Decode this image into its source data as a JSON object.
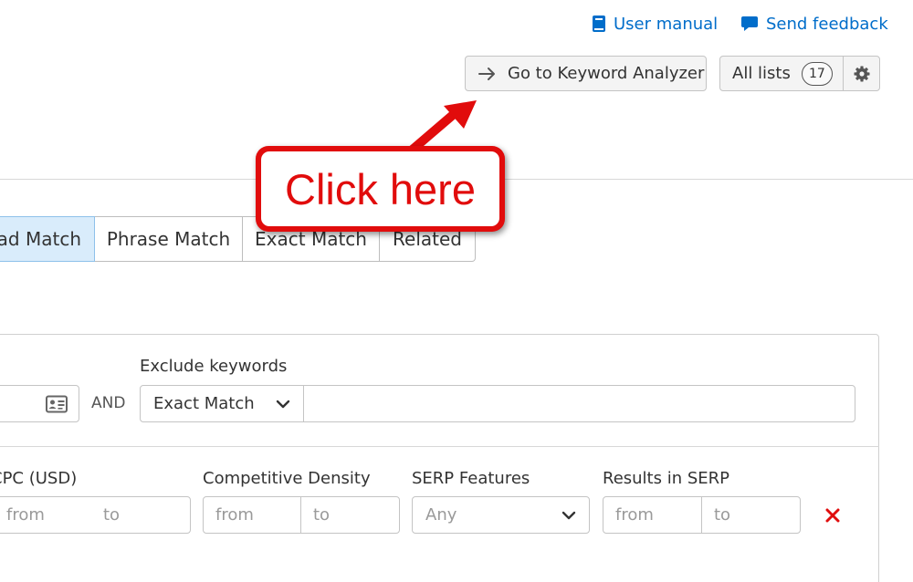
{
  "header": {
    "user_manual": "User manual",
    "send_feedback": "Send feedback"
  },
  "toolbar": {
    "goto_analyzer": "Go to Keyword Analyzer",
    "all_lists": "All lists",
    "lists_count": "17"
  },
  "tabs": [
    {
      "label": "Broad Match",
      "visible": "ad Match",
      "active": true
    },
    {
      "label": "Phrase Match",
      "active": false
    },
    {
      "label": "Exact Match",
      "active": false
    },
    {
      "label": "Related",
      "active": false
    }
  ],
  "filters": {
    "and_label": "AND",
    "exclude_label": "Exclude keywords",
    "exclude_match": "Exact Match",
    "exclude_value": "",
    "cpc_label": "CPC (USD)",
    "cpc_label_visible": "CPC (USD)",
    "density_label": "Competitive Density",
    "serp_label": "SERP Features",
    "serp_value": "Any",
    "results_label": "Results in SERP",
    "from_placeholder": "from",
    "to_placeholder": "to"
  },
  "annotation": {
    "text": "Click here"
  },
  "colors": {
    "link": "#006dca",
    "accent_red": "#e10c0c",
    "active_tab_bg": "#d9ecfb",
    "remove_icon": "#e00d0d"
  },
  "icons": {
    "user_manual": "book-icon",
    "send_feedback": "speech-bubble-icon",
    "goto": "arrow-right-icon",
    "settings": "gear-icon",
    "keyword_list": "contact-card-icon",
    "dropdown": "chevron-down-icon",
    "remove": "close-icon"
  }
}
